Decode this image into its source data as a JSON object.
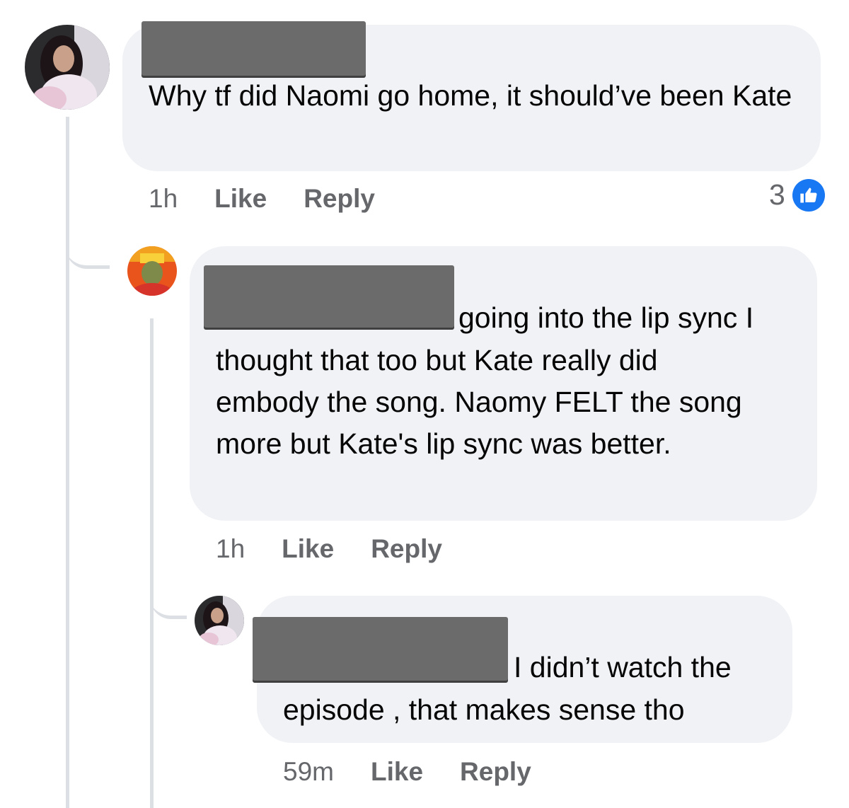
{
  "comments": [
    {
      "text": "Why tf did Naomi go home, it should’ve been Kate",
      "time": "1h",
      "like_label": "Like",
      "reply_label": "Reply",
      "reaction_count": "3"
    },
    {
      "text_line1": "going into the lip sync I",
      "text_rest": "thought that too but Kate really did embody the song.  Naomy FELT the song more but Kate's lip sync was better.",
      "time": "1h",
      "like_label": "Like",
      "reply_label": "Reply"
    },
    {
      "text_line1": "I didn’t watch the",
      "text_rest": "episode , that makes sense tho",
      "time": "59m",
      "like_label": "Like",
      "reply_label": "Reply"
    }
  ],
  "colors": {
    "bubble": "#f0f2f5",
    "meta_text": "#65676b",
    "like_blue": "#1877f2",
    "redaction": "#6b6b6b"
  }
}
